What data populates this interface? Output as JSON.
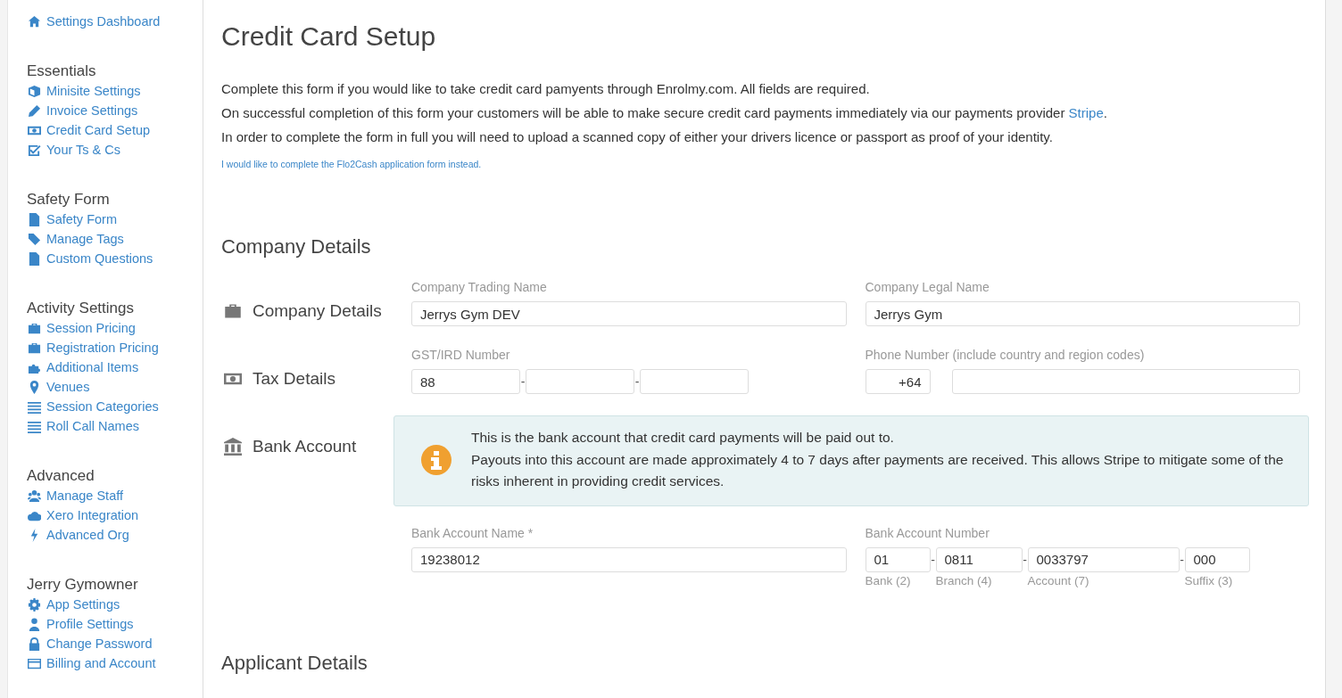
{
  "sidebar": {
    "top_link": "Settings Dashboard",
    "sections": [
      {
        "heading": "Essentials",
        "items": [
          "Minisite Settings",
          "Invoice Settings",
          "Credit Card Setup",
          "Your Ts & Cs"
        ]
      },
      {
        "heading": "Safety Form",
        "items": [
          "Safety Form",
          "Manage Tags",
          "Custom Questions"
        ]
      },
      {
        "heading": "Activity Settings",
        "items": [
          "Session Pricing",
          "Registration Pricing",
          "Additional Items",
          "Venues",
          "Session Categories",
          "Roll Call Names"
        ]
      },
      {
        "heading": "Advanced",
        "items": [
          "Manage Staff",
          "Xero Integration",
          "Advanced Org"
        ]
      },
      {
        "heading": "Jerry Gymowner",
        "items": [
          "App Settings",
          "Profile Settings",
          "Change Password",
          "Billing and Account"
        ]
      }
    ]
  },
  "main": {
    "title": "Credit Card Setup",
    "intro": [
      {
        "text": "Complete this form if you would like to take credit card pamyents through Enrolmy.com. All fields are required."
      },
      {
        "text": "On successful completion of this form your customers will be able to make secure credit card payments immediately via our payments provider",
        "link": "Stripe",
        "after": "."
      },
      {
        "text": "In order to complete the form in full you will need to upload a scanned copy of either your drivers licence or passport as proof of your identity."
      }
    ],
    "alt_link": "I would like to complete the Flo2Cash application form instead.",
    "sections": [
      {
        "heading": "Company Details",
        "groups": [
          {
            "label": "Company Details",
            "fields": [
              {
                "label": "Company Trading Name",
                "parts": [
                  {
                    "kind": "input",
                    "value": "Jerrys Gym DEV"
                  }
                ]
              },
              {
                "label": "Company Legal Name",
                "parts": [
                  {
                    "kind": "input",
                    "value": "Jerrys Gym"
                  }
                ]
              }
            ]
          },
          {
            "label": "Tax Details",
            "fields": [
              {
                "label": "GST/IRD Number",
                "separator": "-",
                "parts": [
                  {
                    "kind": "input",
                    "value": "88"
                  },
                  {
                    "kind": "input"
                  },
                  {
                    "kind": "input"
                  }
                ]
              },
              {
                "label": "Phone Number (include country and region codes)",
                "parts": [
                  {
                    "kind": "input",
                    "value": "+64"
                  },
                  {
                    "kind": "input"
                  }
                ]
              }
            ]
          },
          {
            "label": "Bank Account",
            "notice": [
              "This is the bank account that credit card payments will be paid out to.",
              "Payouts into this account are made approximately 4 to 7 days after payments are received. This allows Stripe to mitigate some of the risks inherent in providing credit services."
            ],
            "fields": [
              {
                "label": "Bank Account Name *",
                "parts": [
                  {
                    "kind": "input",
                    "value": "19238012"
                  }
                ]
              },
              {
                "label": "Bank Account Number",
                "separator": "-",
                "parts": [
                  {
                    "kind": "input",
                    "value": "01",
                    "hint": "Bank (2)"
                  },
                  {
                    "kind": "input",
                    "value": "0811",
                    "hint": "Branch (4)"
                  },
                  {
                    "kind": "input",
                    "value": "0033797",
                    "hint": "Account (7)"
                  },
                  {
                    "kind": "input",
                    "value": "000",
                    "hint": "Suffix (3)"
                  }
                ]
              }
            ]
          }
        ]
      },
      {
        "heading": "Applicant Details"
      }
    ]
  }
}
